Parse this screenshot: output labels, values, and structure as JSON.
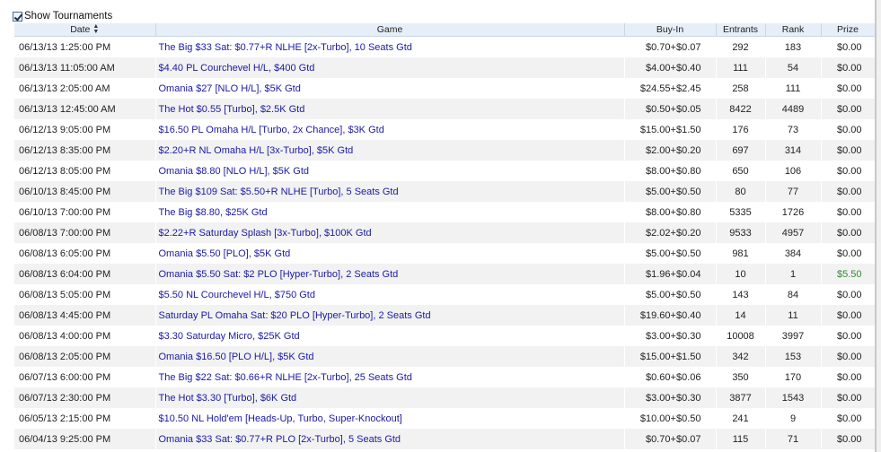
{
  "top": {
    "checkbox_label": "Show Tournaments",
    "checked": true
  },
  "columns": {
    "date": "Date",
    "game": "Game",
    "buyin": "Buy-In",
    "entrants": "Entrants",
    "rank": "Rank",
    "prize": "Prize"
  },
  "rows": [
    {
      "date": "06/13/13 1:25:00 PM",
      "game": "The Big $33 Sat: $0.77+R NLHE [2x-Turbo], 10 Seats Gtd",
      "buyin": "$0.70+$0.07",
      "entrants": "292",
      "rank": "183",
      "prize": "$0.00"
    },
    {
      "date": "06/13/13 11:05:00 AM",
      "game": "$4.40 PL Courchevel H/L, $400 Gtd",
      "buyin": "$4.00+$0.40",
      "entrants": "111",
      "rank": "54",
      "prize": "$0.00"
    },
    {
      "date": "06/13/13 2:05:00 AM",
      "game": "Omania $27 [NLO H/L], $5K Gtd",
      "buyin": "$24.55+$2.45",
      "entrants": "258",
      "rank": "111",
      "prize": "$0.00"
    },
    {
      "date": "06/13/13 12:45:00 AM",
      "game": "The Hot $0.55 [Turbo], $2.5K Gtd",
      "buyin": "$0.50+$0.05",
      "entrants": "8422",
      "rank": "4489",
      "prize": "$0.00"
    },
    {
      "date": "06/12/13 9:05:00 PM",
      "game": "$16.50 PL Omaha H/L [Turbo, 2x Chance], $3K Gtd",
      "buyin": "$15.00+$1.50",
      "entrants": "176",
      "rank": "73",
      "prize": "$0.00"
    },
    {
      "date": "06/12/13 8:35:00 PM",
      "game": "$2.20+R NL Omaha H/L [3x-Turbo], $5K Gtd",
      "buyin": "$2.00+$0.20",
      "entrants": "697",
      "rank": "314",
      "prize": "$0.00"
    },
    {
      "date": "06/12/13 8:05:00 PM",
      "game": "Omania $8.80 [NLO H/L], $5K Gtd",
      "buyin": "$8.00+$0.80",
      "entrants": "650",
      "rank": "106",
      "prize": "$0.00"
    },
    {
      "date": "06/10/13 8:45:00 PM",
      "game": "The Big $109 Sat: $5.50+R NLHE [Turbo], 5 Seats Gtd",
      "buyin": "$5.00+$0.50",
      "entrants": "80",
      "rank": "77",
      "prize": "$0.00"
    },
    {
      "date": "06/10/13 7:00:00 PM",
      "game": "The Big $8.80, $25K Gtd",
      "buyin": "$8.00+$0.80",
      "entrants": "5335",
      "rank": "1726",
      "prize": "$0.00"
    },
    {
      "date": "06/08/13 7:00:00 PM",
      "game": "$2.22+R Saturday Splash [3x-Turbo], $100K Gtd",
      "buyin": "$2.02+$0.20",
      "entrants": "9533",
      "rank": "4957",
      "prize": "$0.00"
    },
    {
      "date": "06/08/13 6:05:00 PM",
      "game": "Omania $5.50 [PLO], $5K Gtd",
      "buyin": "$5.00+$0.50",
      "entrants": "981",
      "rank": "384",
      "prize": "$0.00"
    },
    {
      "date": "06/08/13 6:04:00 PM",
      "game": "Omania $5.50 Sat: $2 PLO [Hyper-Turbo], 2 Seats Gtd",
      "buyin": "$1.96+$0.04",
      "entrants": "10",
      "rank": "1",
      "prize": "$5.50",
      "win": true
    },
    {
      "date": "06/08/13 5:05:00 PM",
      "game": "$5.50 NL Courchevel H/L, $750 Gtd",
      "buyin": "$5.00+$0.50",
      "entrants": "143",
      "rank": "84",
      "prize": "$0.00"
    },
    {
      "date": "06/08/13 4:45:00 PM",
      "game": "Saturday PL Omaha Sat: $20 PLO [Hyper-Turbo], 2 Seats Gtd",
      "buyin": "$19.60+$0.40",
      "entrants": "14",
      "rank": "11",
      "prize": "$0.00"
    },
    {
      "date": "06/08/13 4:00:00 PM",
      "game": "$3.30 Saturday Micro, $25K Gtd",
      "buyin": "$3.00+$0.30",
      "entrants": "10008",
      "rank": "3997",
      "prize": "$0.00"
    },
    {
      "date": "06/08/13 2:05:00 PM",
      "game": "Omania $16.50 [PLO H/L], $5K Gtd",
      "buyin": "$15.00+$1.50",
      "entrants": "342",
      "rank": "153",
      "prize": "$0.00"
    },
    {
      "date": "06/07/13 6:00:00 PM",
      "game": "The Big $22 Sat: $0.66+R NLHE [2x-Turbo], 25 Seats Gtd",
      "buyin": "$0.60+$0.06",
      "entrants": "350",
      "rank": "170",
      "prize": "$0.00"
    },
    {
      "date": "06/07/13 2:30:00 PM",
      "game": "The Hot $3.30 [Turbo], $6K Gtd",
      "buyin": "$3.00+$0.30",
      "entrants": "3877",
      "rank": "1543",
      "prize": "$0.00"
    },
    {
      "date": "06/05/13 2:15:00 PM",
      "game": "$10.50 NL Hold'em [Heads-Up, Turbo, Super-Knockout]",
      "buyin": "$10.00+$0.50",
      "entrants": "241",
      "rank": "9",
      "prize": "$0.00"
    },
    {
      "date": "06/04/13 9:25:00 PM",
      "game": "Omania $33 Sat: $0.77+R PLO [2x-Turbo], 5 Seats Gtd",
      "buyin": "$0.70+$0.07",
      "entrants": "115",
      "rank": "71",
      "prize": "$0.00"
    }
  ],
  "colors": {
    "link": "#1a1aa6",
    "win": "#2e8b2e",
    "header_bg": "#e6eef7",
    "row_alt": "#f2f2f2"
  }
}
